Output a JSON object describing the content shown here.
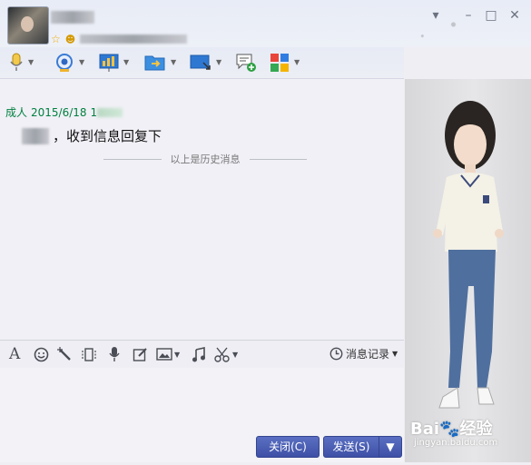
{
  "window": {
    "status_star": "☆",
    "qzone_symbol": "☻"
  },
  "toolbar": {
    "items": [
      {
        "name": "voice-call",
        "icon": "microphone-icon"
      },
      {
        "name": "video-call",
        "icon": "webcam-icon"
      },
      {
        "name": "remote-desktop",
        "icon": "presentation-icon"
      },
      {
        "name": "send-file",
        "icon": "folder-transfer-icon"
      },
      {
        "name": "screen-share",
        "icon": "screen-icon"
      },
      {
        "name": "create-discussion",
        "icon": "chat-add-icon"
      },
      {
        "name": "apps",
        "icon": "apps-grid-icon"
      }
    ]
  },
  "chat": {
    "message": {
      "sender": "成人",
      "date": "2015/6/18",
      "time_prefix": "1",
      "text": "，收到信息回复下"
    },
    "history_divider": "以上是历史消息"
  },
  "input_toolbar": {
    "font_glyph": "A",
    "history_label": "消息记录"
  },
  "buttons": {
    "close": "关闭(C)",
    "send": "发送(S)"
  },
  "watermark": {
    "brand": "Bai🐾经验",
    "url": "jingyan.baidu.com"
  },
  "colors": {
    "sender_green": "#008040",
    "button_blue": "#4458b1"
  }
}
